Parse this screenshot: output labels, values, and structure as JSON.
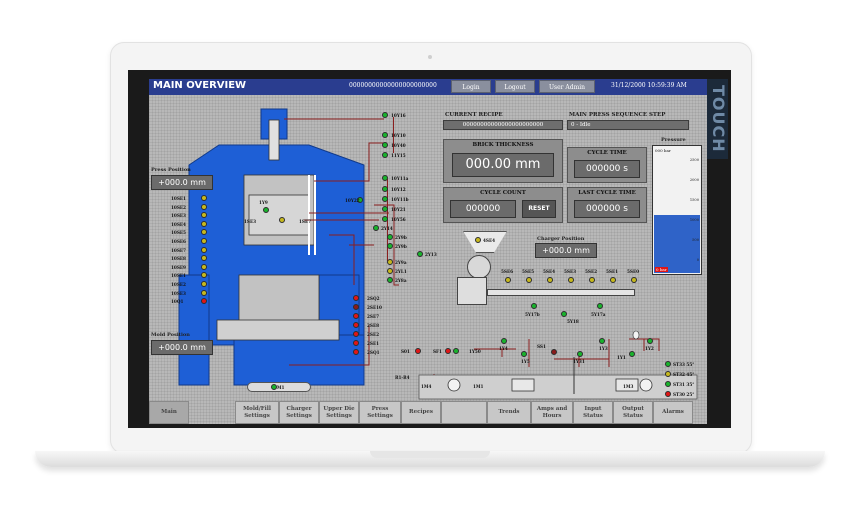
{
  "header": {
    "title": "MAIN OVERVIEW",
    "code": "00000000000000000000000",
    "login": "Login",
    "logout": "Logout",
    "user": "User Admin",
    "datetime": "31/12/2000   10:59:39 AM"
  },
  "brand_vertical": "TOUCH",
  "recipe": {
    "current_label": "CURRENT RECIPE",
    "current_value": "00000000000000000000000",
    "step_label": "MAIN PRESS SEQUENCE STEP",
    "step_value": "0 - Idle"
  },
  "brick_thickness": {
    "label": "BRICK THICKNESS",
    "value": "000.00 mm"
  },
  "cycle_time": {
    "label": "CYCLE TIME",
    "value": "000000 s"
  },
  "cycle_count": {
    "label": "CYCLE COUNT",
    "value": "000000",
    "reset": "RESET"
  },
  "last_cycle_time": {
    "label": "LAST CYCLE TIME",
    "value": "000000 s"
  },
  "pressure": {
    "label": "Pressure",
    "top_value": "000 bar",
    "low_value": "0 bar",
    "level": 0.45,
    "ticks": [
      "2500",
      "2000",
      "1500",
      "1000",
      "500",
      "0"
    ]
  },
  "press_position": {
    "label": "Press Position",
    "value": "+000.0 mm"
  },
  "mold_position": {
    "label": "Mold Position",
    "value": "+000.0 mm"
  },
  "charger_position": {
    "label": "Charger Position",
    "value": "+000.0 mm"
  },
  "left_sensors": [
    "10SE1",
    "10SE2",
    "10SE3",
    "10SE4",
    "10SE5",
    "10SE6",
    "10SE7",
    "10SE8",
    "10SE9",
    "10SE1",
    "10SE2",
    "10SE3",
    "10Q1"
  ],
  "top_valves": [
    "10Y16",
    "10Y10",
    "10Y40",
    "11Y15"
  ],
  "mid_valves": [
    "10Y11a",
    "10Y12",
    "10Y11b",
    "10Y21",
    "10Y56"
  ],
  "right_valves": [
    "2Y14",
    "2Y9b",
    "2Y9b",
    "2Y13",
    "2Y9a",
    "2YL1",
    "2Y8a"
  ],
  "misc_tags": {
    "y9": "1Y9",
    "se3": "1SE3",
    "se7": "1SE7",
    "y22": "10Y22",
    "se4": "4SE4",
    "m1": "3M1"
  },
  "sq_sensors": [
    "2SQ2",
    "2SE10",
    "2SE7",
    "2SE8",
    "2SE2",
    "2SE1",
    "2SQ1"
  ],
  "charger_sensors": [
    "5SE6",
    "5SE5",
    "5SE4",
    "5SE3",
    "5SE2",
    "5SE1",
    "5SE0"
  ],
  "charger_valves": {
    "a": "5Y17b",
    "b": "5Y17a",
    "c": "5Y18"
  },
  "hydraulic": {
    "s01": "S01",
    "sf1": "SF1",
    "y50": "1Y50",
    "ss1": "SS1",
    "y4": "1Y4",
    "y5": "1Y5",
    "y31": "1Y31",
    "y3": "1Y3",
    "y1": "1Y1",
    "y2": "1Y2",
    "r1": "R1-R4",
    "m4": "1M4",
    "m1": "1M1",
    "m3": "1M3"
  },
  "temps": [
    {
      "label": "ST33 55°",
      "color": "#19b22c"
    },
    {
      "label": "ST32 45°",
      "color": "#c6b81e"
    },
    {
      "label": "ST31 35°",
      "color": "#19b22c"
    },
    {
      "label": "ST30 25°",
      "color": "#e01616"
    }
  ],
  "nav": [
    "Main",
    "Mold/Fill Settings",
    "Charger Settings",
    "Upper Die Settings",
    "Press Settings",
    "Recipes",
    "",
    "Trends",
    "Amps and Hours",
    "Input Status",
    "Output Status",
    "Alarms"
  ]
}
